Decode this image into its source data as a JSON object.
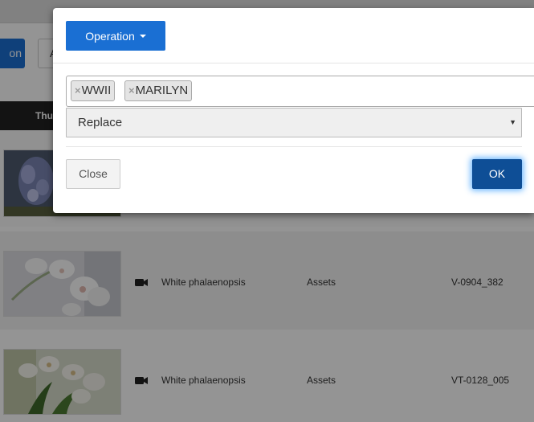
{
  "background": {
    "toolbar": {
      "primary_button_partial": "on",
      "secondary_button_partial": "A"
    },
    "table": {
      "header_partial": "Thu",
      "rows": [
        {
          "title": "",
          "type": "",
          "code": ""
        },
        {
          "title": "White phalaenopsis",
          "type": "Assets",
          "code": "V-0904_382",
          "media_icon": "video-camera-icon"
        },
        {
          "title": "White phalaenopsis",
          "type": "Assets",
          "code": "VT-0128_005",
          "media_icon": "video-camera-icon"
        }
      ]
    }
  },
  "modal": {
    "operation_button": "Operation",
    "tags": [
      {
        "remove": "×",
        "label": "WWII"
      },
      {
        "remove": "×",
        "label": "MARILYN"
      }
    ],
    "mode_select": {
      "selected": "Replace",
      "arrow": "▼"
    },
    "close_button": "Close",
    "ok_button": "OK"
  },
  "colors": {
    "primary": "#1a6fd3",
    "ok_button": "#0e4e96",
    "header_bg": "#222222"
  }
}
